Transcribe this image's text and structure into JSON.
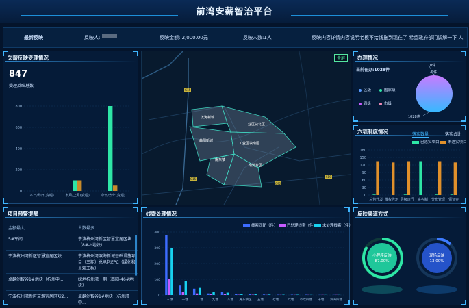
{
  "header": {
    "title": "前湾安薪智治平台"
  },
  "ticker": {
    "label": "最新反映",
    "reporter_label": "反映人:",
    "amount": "反映金额: 2,000.00元",
    "count": "反映人数:1人",
    "content": "反映内容详情内容说明老板不给钱拖到现在了 希望政府部门调解一下 人"
  },
  "complaints": {
    "title": "欠薪反映受理情况",
    "total": "847",
    "total_label": "受理反映总数",
    "chart_data": {
      "type": "bar",
      "categories": [
        "本日/昨日(变幅)",
        "本月/上月(变幅)",
        "今年/去年(变幅)"
      ],
      "ylim": [
        0,
        800
      ],
      "yticks": [
        "0",
        "200",
        "400",
        "600",
        "800"
      ],
      "series": [
        {
          "values": [
            0,
            100,
            800
          ],
          "color": "#2ee6a6"
        },
        {
          "values": [
            0,
            100,
            50
          ],
          "color": "#c88a2a"
        }
      ]
    }
  },
  "map": {
    "fullscreen": "全屏",
    "zones": [
      "滨海新城",
      "工业区块北区",
      "曲阳新城",
      "工业区块南区",
      "南湾片区",
      "庵东镇"
    ],
    "road_tags": [
      "G15",
      "G15",
      "G92",
      "S19"
    ]
  },
  "handling": {
    "title": "办理情况",
    "current": "当前在办:1028件",
    "chart_data": {
      "type": "pie",
      "labels": [
        "区级",
        "国家级",
        "省级",
        "市级"
      ],
      "colors": [
        "#5a9bff",
        "#2ee6a6",
        "#c65bff",
        "#f08ab6"
      ],
      "annotations": [
        "0件",
        "0件",
        "1028件"
      ]
    }
  },
  "six": {
    "title": "六项制度情况",
    "tab_active": "落实数量",
    "tab_inactive": "落实占比",
    "chart_data": {
      "type": "bar",
      "categories": [
        "总包代发",
        "实名管理",
        "分账管理",
        "保证金",
        "维权告示",
        "实名制"
      ],
      "xticks": [
        "总包代发",
        "维权告示",
        "层级运行",
        "实名制",
        "分布管理",
        "保证金"
      ],
      "ylim": [
        0,
        180
      ],
      "yticks": [
        "0",
        "30",
        "60",
        "90",
        "120",
        "150",
        "180"
      ],
      "series": [
        {
          "name": "已落实项目",
          "values": [
            2,
            0,
            2,
            135,
            2,
            2
          ],
          "color": "#2ee6a6"
        },
        {
          "name": "未落实项目",
          "values": [
            135,
            130,
            135,
            0,
            135,
            130
          ],
          "color": "#e0902b"
        }
      ]
    }
  },
  "project": {
    "title": "项目预警提醒",
    "col1": "金额最大",
    "col2": "人数最多",
    "rows": [
      {
        "a": "5#车间",
        "b": "宁波杭州湾新区智慧宜居区块（8#-b地块）"
      },
      {
        "a": "宁波杭州湾新区智慧宜居区块...",
        "b": "宁波杭州湾滨海新城基础设施项目（三期）总承包EPC（绿化和景观工程）"
      },
      {
        "a": "卓越创智谷1#地块（杭州中...",
        "b": "绿地杭州湾一期（南阳-46#地块）"
      },
      {
        "a": "宁波杭州湾新区文源宜居区块2...",
        "b": "卓越创智谷1#地块（杭州湾中..."
      }
    ]
  },
  "clues": {
    "title": "线索处理情况",
    "legend": [
      "线索匹配（件）",
      "已处理线索（件）",
      "未处理线索（件）"
    ],
    "chart_data": {
      "type": "bar",
      "categories": [
        "三墩",
        "一墩",
        "二墩",
        "九塘",
        "八塘",
        "庵东镇",
        "西塘",
        "五塘",
        "七塘",
        "六塘",
        "市政",
        "十塘",
        "滨海新城"
      ],
      "xticks": [
        "三墩",
        "一塘",
        "二塘",
        "九塘",
        "八塘",
        "庵东镇区",
        "五塘",
        "七塘",
        "六塘",
        "市政四塘",
        "十塘",
        "滨海四塘"
      ],
      "ylim": [
        0,
        400
      ],
      "yticks": [
        "0",
        "100",
        "200",
        "300",
        "400"
      ],
      "series": [
        {
          "name": "线索匹配（件）",
          "values": [
            380,
            60,
            40,
            10,
            20,
            5,
            5,
            3,
            2,
            2,
            2,
            1,
            1
          ],
          "color": "#3d6cff"
        },
        {
          "name": "已处理线索（件）",
          "values": [
            100,
            20,
            10,
            5,
            5,
            2,
            2,
            1,
            1,
            1,
            1,
            1,
            1
          ],
          "color": "#c65bff"
        },
        {
          "name": "未处理线索（件）",
          "values": [
            300,
            90,
            45,
            20,
            15,
            8,
            5,
            3,
            2,
            2,
            1,
            1,
            1
          ],
          "color": "#18d2f0"
        }
      ]
    }
  },
  "channels": {
    "title": "反映渠道方式",
    "left_label": "小程序反映",
    "left_value": "87.00%",
    "right_label": "现场反映",
    "right_value": "13.00%"
  },
  "colors": {
    "accent": "#3fb6ff",
    "green": "#2ee6a6",
    "orange": "#e0902b"
  }
}
